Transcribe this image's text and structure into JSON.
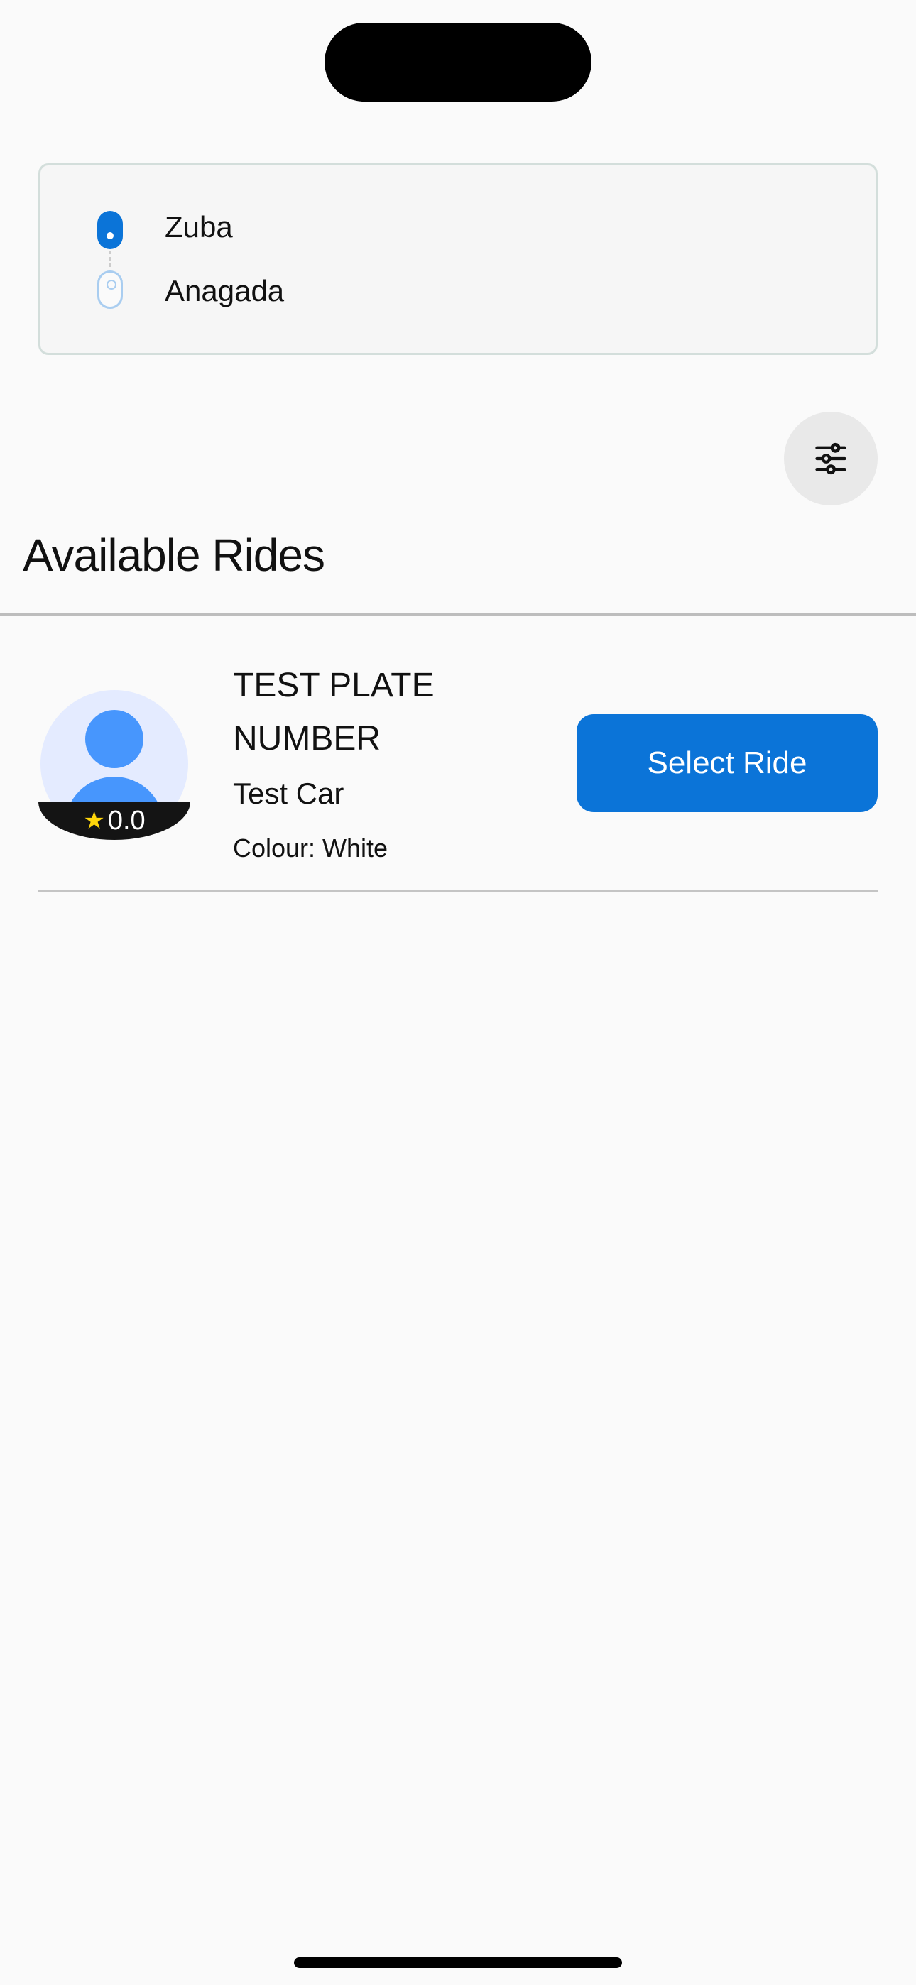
{
  "route": {
    "pickup": "Zuba",
    "dropoff": "Anagada"
  },
  "filter_icon": "sliders-icon",
  "section_title": "Available Rides",
  "rides": [
    {
      "plate": "TEST PLATE NUMBER",
      "car": "Test Car",
      "colour": "Colour: White",
      "rating": "0.0",
      "button_label": "Select Ride"
    }
  ],
  "colors": {
    "accent": "#0b74d8",
    "avatar": "#4796fd",
    "star": "#ffd60a"
  }
}
